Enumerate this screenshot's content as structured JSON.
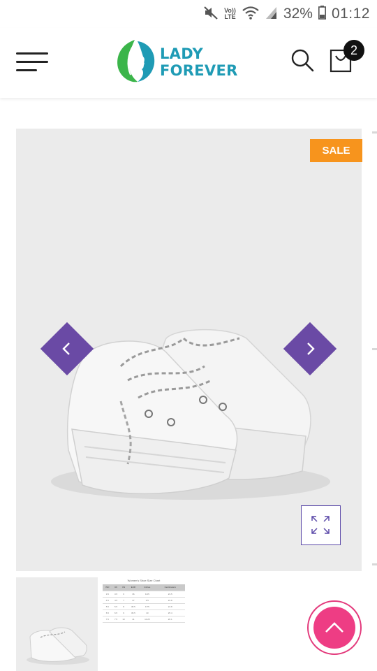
{
  "status_bar": {
    "volte_top": "Vo))",
    "volte_bottom": "LTE",
    "battery": "32%",
    "time": "01:12"
  },
  "header": {
    "brand": "LADY FOREVER",
    "cart_count": "2",
    "brand_colors": {
      "leaf_green": "#3bb54a",
      "face_teal": "#1f9bb5"
    }
  },
  "product": {
    "badge": "SALE",
    "badge_color": "#f7941d",
    "nav_color": "#6a4aa5"
  },
  "thumbnails": {
    "size_chart_title": "Women's Shoe Size Chart",
    "size_chart_headers": [
      "IND",
      "UK",
      "US",
      "EUR",
      "Inches",
      "Centimeters"
    ],
    "size_chart_rows": [
      [
        "3.5",
        "3.5",
        "6",
        "36",
        "9.25",
        "23.5"
      ],
      [
        "4.5",
        "4.5",
        "7",
        "37",
        "9.5",
        "23.8"
      ],
      [
        "5.5",
        "5.5",
        "8",
        "38.5",
        "9.75",
        "24.8"
      ],
      [
        "6.5",
        "6.5",
        "9",
        "39.5",
        "10",
        "25.4"
      ],
      [
        "7.5",
        "7.5",
        "10",
        "41",
        "10.25",
        "26.1"
      ]
    ]
  },
  "scroll_top_color": "#ee3d84"
}
